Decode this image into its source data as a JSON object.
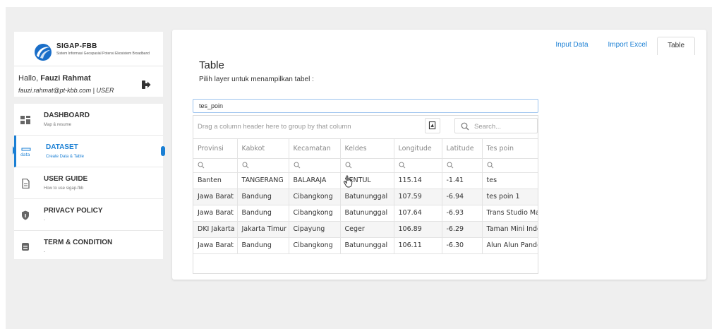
{
  "brand": {
    "title": "SIGAP-FBB",
    "subtitle": "Sistem Informasi Geospasial Potensi Ekosistem Broadband"
  },
  "user": {
    "greeting": "Hallo, ",
    "name": "Fauzi Rahmat",
    "email": "fauzi.rahmat@pt-kbb.com | USER"
  },
  "menu": [
    {
      "label": "DASHBOARD",
      "desc": "Map & resume",
      "icon": "dashboard-icon"
    },
    {
      "label": "DATASET",
      "desc": "Create Data & Table",
      "icon": "data-icon",
      "active": true,
      "icon_text": "data"
    },
    {
      "label": "USER GUIDE",
      "desc": "How to use sigap-fbb",
      "icon": "document-icon"
    },
    {
      "label": "PRIVACY POLICY",
      "desc": "-",
      "icon": "shield-icon"
    },
    {
      "label": "TERM & CONDITION",
      "desc": "-",
      "icon": "message-icon"
    }
  ],
  "tabs": [
    {
      "label": "Input Data",
      "active": false
    },
    {
      "label": "Import Excel",
      "active": false
    },
    {
      "label": "Table",
      "active": true
    }
  ],
  "page": {
    "title": "Table",
    "subtitle": "Pilih layer untuk menampilkan tabel :"
  },
  "layer_select": {
    "value": "tes_poin"
  },
  "grid": {
    "group_panel_text": "Drag a column header here to group by that column",
    "search_placeholder": "Search...",
    "columns": [
      "Provinsi",
      "Kabkot",
      "Kecamatan",
      "Keldes",
      "Longitude",
      "Latitude",
      "Tes poin"
    ],
    "rows": [
      [
        "Banten",
        "TANGERANG",
        "BALARAJA",
        "SENTUL",
        "115.14",
        "-1.41",
        "tes"
      ],
      [
        "Jawa Barat",
        "Bandung",
        "Cibangkong",
        "Batununggal",
        "107.59",
        "-6.94",
        "tes poin 1"
      ],
      [
        "Jawa Barat",
        "Bandung",
        "Cibangkong",
        "Batununggal",
        "107.64",
        "-6.93",
        "Trans Studio Mall"
      ],
      [
        "DKI Jakarta",
        "Jakarta Timur",
        "Cipayung",
        "Ceger",
        "106.89",
        "-6.29",
        "Taman Mini Indonesia Indah"
      ],
      [
        "Jawa Barat",
        "Bandung",
        "Cibangkong",
        "Batununggal",
        "106.11",
        "-6.30",
        "Alun Alun Pandeglang"
      ]
    ]
  },
  "colors": {
    "accent": "#1a7fd4",
    "background": "#efefef"
  }
}
